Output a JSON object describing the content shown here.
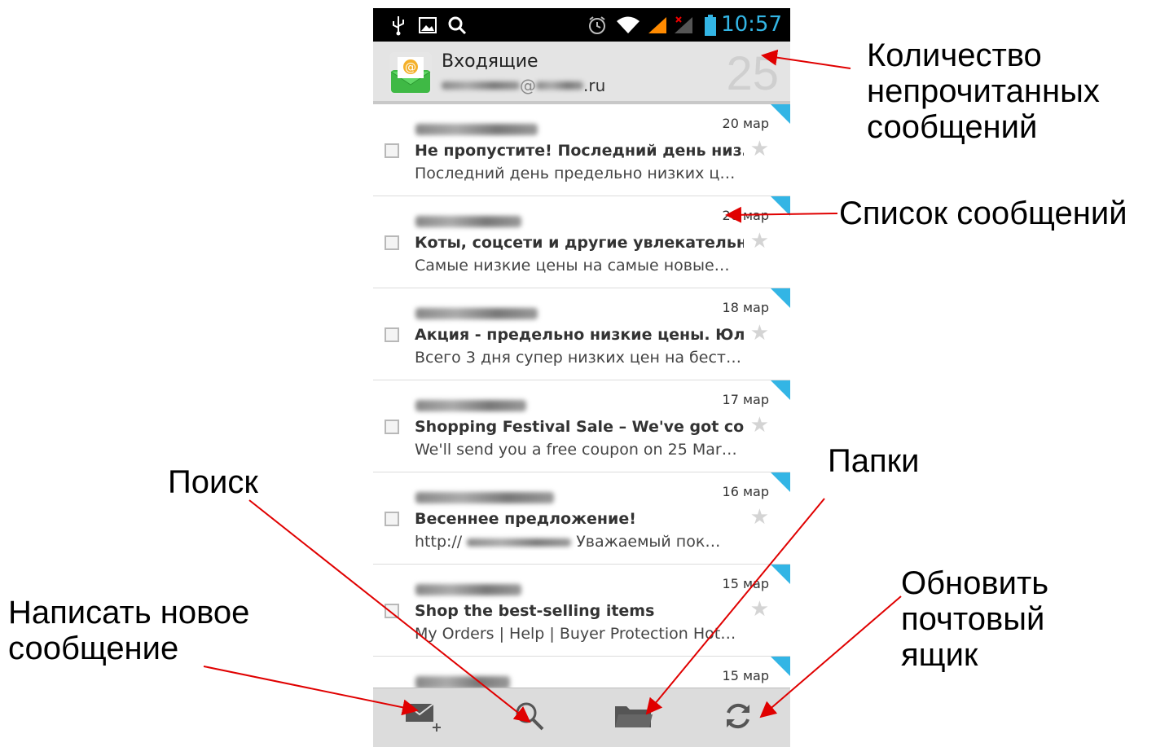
{
  "status_bar": {
    "time": "10:57",
    "icons": [
      "usb-icon",
      "image-icon",
      "search-icon",
      "alarm-icon",
      "wifi-icon",
      "signal-icon",
      "no-signal-icon",
      "battery-icon"
    ]
  },
  "header": {
    "title": "Входящие",
    "account_visible": "@",
    "account_domain": ".ru",
    "unread_count": "25"
  },
  "messages": [
    {
      "date": "20 мар",
      "subject": "Не пропустите! Последний день низ…",
      "preview": "Последний день предельно низких ц…"
    },
    {
      "date": "20 мар",
      "subject": "Коты, соцсети и другие увлекательн…",
      "preview": "Самые низкие цены на самые новые…"
    },
    {
      "date": "18 мар",
      "subject": "Акция - предельно низкие цены. Юл…",
      "preview": "Всего 3 дня супер низких цен на бест…"
    },
    {
      "date": "17 мар",
      "subject": "Shopping Festival Sale – We've got co…",
      "preview": "We'll send you a free coupon on 25 Mar…"
    },
    {
      "date": "16 мар",
      "subject": "Весеннее предложение!",
      "preview_prefix": "http://",
      "preview": "Уважаемый пок…"
    },
    {
      "date": "15 мар",
      "subject": "Shop the best-selling items",
      "preview": "My Orders | Help | Buyer Protection Hot…"
    },
    {
      "date": "15 мар",
      "subject": "",
      "preview": ""
    }
  ],
  "toolbar": {
    "buttons": [
      "compose-icon",
      "search-icon",
      "folder-icon",
      "refresh-icon"
    ]
  },
  "annotations": {
    "unread": "Количество\nнепрочитанных\nсообщений",
    "list": "Список сообщений",
    "folders": "Папки",
    "search": "Поиск",
    "compose": "Написать новое\nсообщение",
    "refresh": "Обновить\nпочтовый\nящик"
  },
  "colors": {
    "accent": "#33b5e5",
    "arrow": "#e00000"
  }
}
